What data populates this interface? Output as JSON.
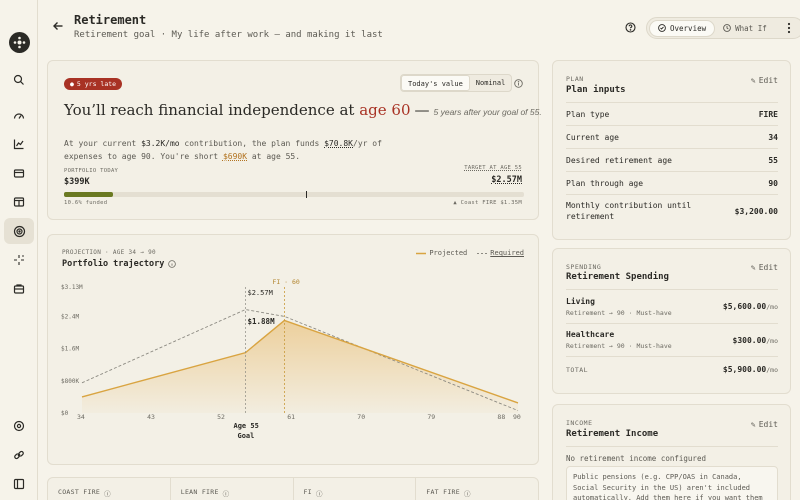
{
  "header": {
    "title": "Retirement",
    "subtitle": "Retirement goal · My life after work — and making it last",
    "tabs": [
      {
        "label": "Overview",
        "active": true
      },
      {
        "label": "What If",
        "active": false
      }
    ]
  },
  "sidebar": {
    "items": [
      "logo",
      "search",
      "dashboard",
      "charts",
      "budget",
      "accounts",
      "goals",
      "insights",
      "bank",
      "settings",
      "integrations",
      "collapse"
    ],
    "active": "goals"
  },
  "summary": {
    "badge": "5 yrs late",
    "toggle": [
      "Today's value",
      "Nominal"
    ],
    "headline_pre": "You’ll reach financial independence at",
    "headline_age": "age 60",
    "headline_dash": "—",
    "headline_aside": "5 years after your goal of 55.",
    "para1": "At your current ",
    "contribution": "$3.2K/mo",
    "para2": " contribution, the plan funds ",
    "funds": "$70.8K",
    "para3": "/yr of expenses to age 90. You're short ",
    "short": "$690K",
    "para4": " at age 55.",
    "portfolio_label": "PORTFOLIO TODAY",
    "portfolio_value": "$399K",
    "target_label": "TARGET AT AGE 55",
    "target_value": "$2.57M",
    "funded_text": "10.6% funded",
    "funded_pct": 10.6,
    "coast_text": "▲ Coast FIRE $1.35M",
    "coast_pct": 52.5
  },
  "chart_data": {
    "type": "line",
    "kicker": "PROJECTION · AGE 34 → 90",
    "title": "Portfolio trajectory",
    "legend": [
      "Projected",
      "Required"
    ],
    "x": [
      34,
      55,
      60,
      90
    ],
    "xticks": [
      34,
      43,
      52,
      61,
      70,
      79,
      88,
      90
    ],
    "yticks": [
      "$0",
      "$800K",
      "$1.6M",
      "$2.4M",
      "$3.13M"
    ],
    "ylim": [
      0,
      3130000
    ],
    "series": [
      {
        "name": "Projected",
        "points": [
          [
            34,
            400000
          ],
          [
            55,
            1500000
          ],
          [
            60,
            2300000
          ],
          [
            90,
            250000
          ]
        ]
      },
      {
        "name": "Required",
        "points": [
          [
            34,
            750000
          ],
          [
            55,
            2570000
          ],
          [
            60,
            2400000
          ],
          [
            90,
            60000
          ]
        ]
      }
    ],
    "annotations": {
      "goal_age": 55,
      "goal_label": "Age 55",
      "goal_sub": "Goal",
      "fi_label": "FI · 60",
      "fi_age": 60,
      "required_value": "$2.57M",
      "projected_value": "$1.88M"
    }
  },
  "stats": [
    "COAST FIRE",
    "LEAN FIRE",
    "FI",
    "FAT FIRE"
  ],
  "plan": {
    "section": "PLAN",
    "title": "Plan inputs",
    "edit": "Edit",
    "rows": [
      {
        "label": "Plan type",
        "value": "FIRE"
      },
      {
        "label": "Current age",
        "value": "34"
      },
      {
        "label": "Desired retirement age",
        "value": "55"
      },
      {
        "label": "Plan through age",
        "value": "90"
      },
      {
        "label": "Monthly contribution until retirement",
        "value": "$3,200.00"
      }
    ]
  },
  "spending": {
    "section": "SPENDING",
    "title": "Retirement Spending",
    "edit": "Edit",
    "items": [
      {
        "name": "Living",
        "meta": "Retirement → 90 · Must-have",
        "value": "$5,600.00",
        "unit": "/mo"
      },
      {
        "name": "Healthcare",
        "meta": "Retirement → 90 · Must-have",
        "value": "$300.00",
        "unit": "/mo"
      }
    ],
    "total_label": "TOTAL",
    "total_value": "$5,900.00",
    "total_unit": "/mo"
  },
  "income": {
    "section": "INCOME",
    "title": "Retirement Income",
    "edit": "Edit",
    "empty": "No retirement income configured",
    "note": "Public pensions (e.g. CPP/OAS in Canada, Social Security in the US) aren't included automatically. Add them here if you want them in"
  }
}
